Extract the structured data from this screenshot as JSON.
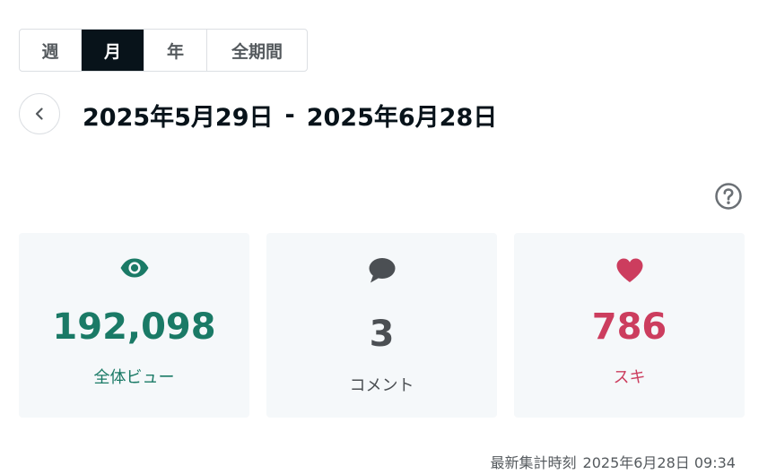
{
  "period_tabs": [
    {
      "label": "週",
      "active": false
    },
    {
      "label": "月",
      "active": true
    },
    {
      "label": "年",
      "active": false
    },
    {
      "label": "全期間",
      "active": false
    }
  ],
  "date_range": {
    "start": "2025年5月29日",
    "separator": "-",
    "end": "2025年6月28日"
  },
  "stats": {
    "views": {
      "value": "192,098",
      "label": "全体ビュー",
      "icon": "eye-icon",
      "color": "#1a7a66"
    },
    "comments": {
      "value": "3",
      "label": "コメント",
      "icon": "comment-icon",
      "color": "#4b4f53"
    },
    "likes": {
      "value": "786",
      "label": "スキ",
      "icon": "heart-icon",
      "color": "#cc3d5e"
    }
  },
  "updated": {
    "label": "最新集計時刻",
    "timestamp": "2025年6月28日 09:34"
  },
  "icons": {
    "prev": "chevron-left-icon",
    "help": "question-circle-icon"
  },
  "colors": {
    "active_tab_bg": "#08131a",
    "card_bg": "#f5f8fa",
    "border": "#dcdfe3"
  }
}
